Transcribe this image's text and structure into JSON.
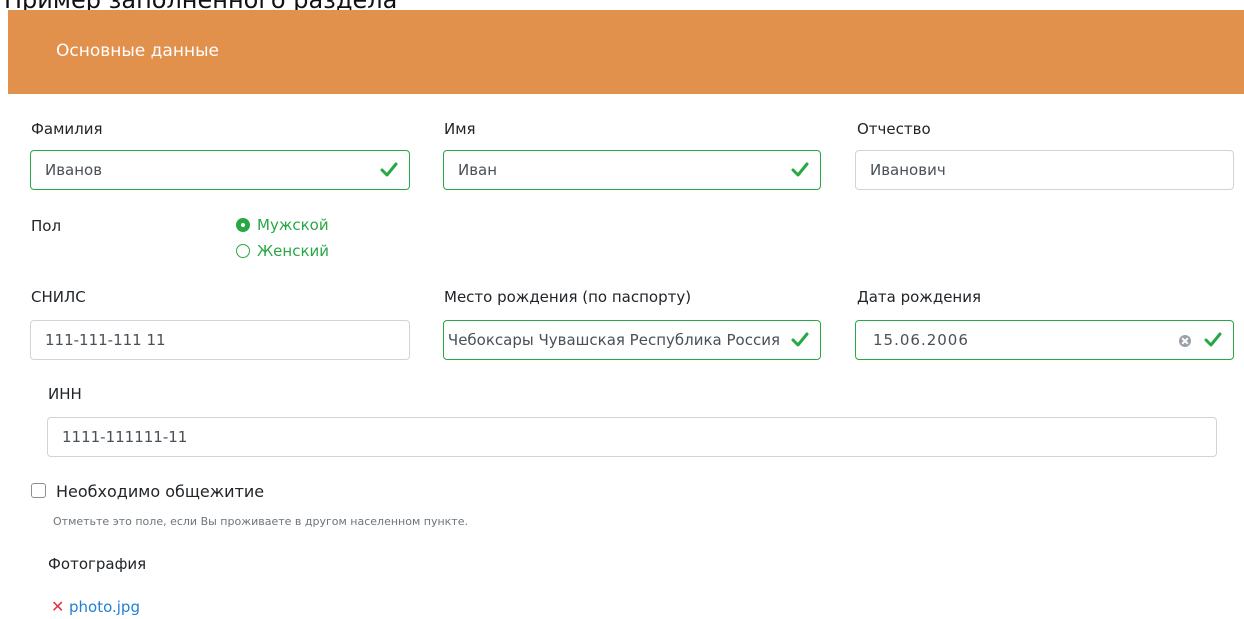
{
  "page": {
    "title": "Пример заполненного раздела"
  },
  "section": {
    "title": "Основные данные"
  },
  "fields": {
    "last_name": {
      "label": "Фамилия",
      "value": "Иванов"
    },
    "first_name": {
      "label": "Имя",
      "value": "Иван"
    },
    "middle_name": {
      "label": "Отчество",
      "value": "Иванович"
    },
    "snils": {
      "label": "СНИЛС",
      "value": "111-111-111 11"
    },
    "birthplace": {
      "label": "Место рождения (по паспорту)",
      "value": "Чебоксары Чувашская Республика Россия"
    },
    "birth_date": {
      "label": "Дата рождения",
      "value": "15.06.2006"
    },
    "inn": {
      "label": "ИНН",
      "value": "1111-111111-11"
    }
  },
  "gender": {
    "label": "Пол",
    "options": [
      "Мужской",
      "Женский"
    ],
    "selected": "Мужской"
  },
  "dormitory": {
    "label": "Необходимо общежитие",
    "checked": false,
    "help": "Отметьте это поле, если Вы проживаете в другом населенном пункте."
  },
  "photo": {
    "label": "Фотография",
    "file_name": "photo.jpg"
  },
  "colors": {
    "header": "#e2914d",
    "valid": "#28a745",
    "link": "#1f7fd8",
    "remove": "#dc3545"
  },
  "icons": {
    "valid": "check-icon",
    "clear": "clear-icon",
    "remove": "remove-icon"
  }
}
